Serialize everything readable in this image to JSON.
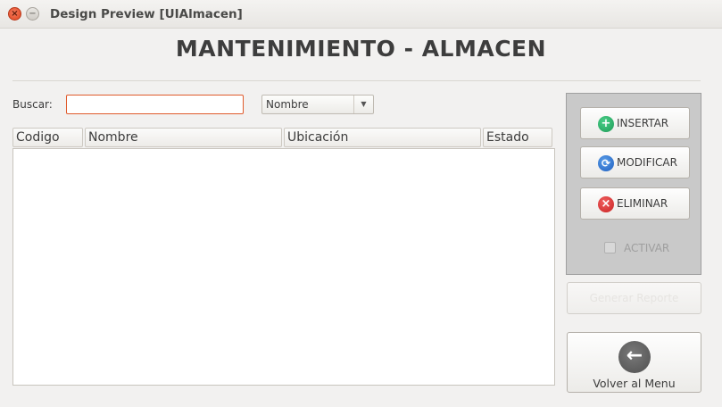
{
  "window": {
    "title": "Design Preview [UIAlmacen]",
    "close_glyph": "×",
    "minimize_glyph": "−"
  },
  "header": {
    "title": "MANTENIMIENTO - ALMACEN"
  },
  "search": {
    "label": "Buscar:",
    "value": "",
    "placeholder": "",
    "filter_selected": "Nombre",
    "filter_arrow": "▼"
  },
  "table": {
    "columns": [
      "Codigo",
      "Nombre",
      "Ubicación",
      "Estado"
    ],
    "rows": []
  },
  "actions": {
    "insert": {
      "label": "INSERTAR",
      "icon": "plus-circle-icon",
      "glyph": "+",
      "color": "#1e9a56"
    },
    "modify": {
      "label": "MODIFICAR",
      "icon": "refresh-icon",
      "glyph": "⟳",
      "color": "#1f5fc0"
    },
    "delete": {
      "label": "ELIMINAR",
      "icon": "x-circle-icon",
      "glyph": "×",
      "color": "#c92222"
    },
    "activate": {
      "label": "ACTIVAR",
      "checked": false,
      "enabled": false
    }
  },
  "secondary": {
    "disabled_label": "Generar Reporte"
  },
  "back": {
    "label": "Volver al Menu",
    "icon": "arrow-left-circle-icon",
    "glyph": "←"
  }
}
